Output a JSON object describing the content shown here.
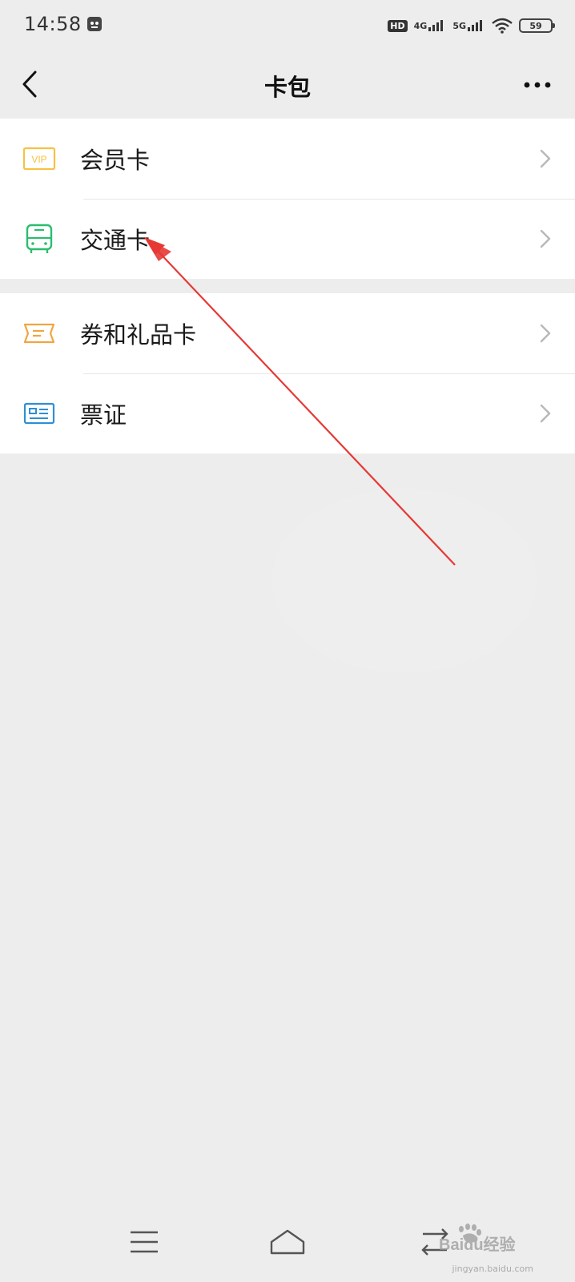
{
  "status_bar": {
    "time": "14:58",
    "hd_label": "HD",
    "net_1": "4G",
    "net_2": "5G",
    "battery": "59"
  },
  "nav": {
    "title": "卡包"
  },
  "groups": [
    {
      "items": [
        {
          "label": "会员卡",
          "icon": "vip-card-icon",
          "color": "#f5c242"
        },
        {
          "label": "交通卡",
          "icon": "bus-icon",
          "color": "#2bbd6e"
        }
      ]
    },
    {
      "items": [
        {
          "label": "券和礼品卡",
          "icon": "ticket-coupon-icon",
          "color": "#f0a640"
        },
        {
          "label": "票证",
          "icon": "id-card-icon",
          "color": "#2f8fd4"
        }
      ]
    }
  ],
  "colors": {
    "background": "#ededed",
    "annotation_arrow": "#e53935"
  },
  "watermark": {
    "brand": "Baidu经验",
    "url": "jingyan.baidu.com"
  }
}
